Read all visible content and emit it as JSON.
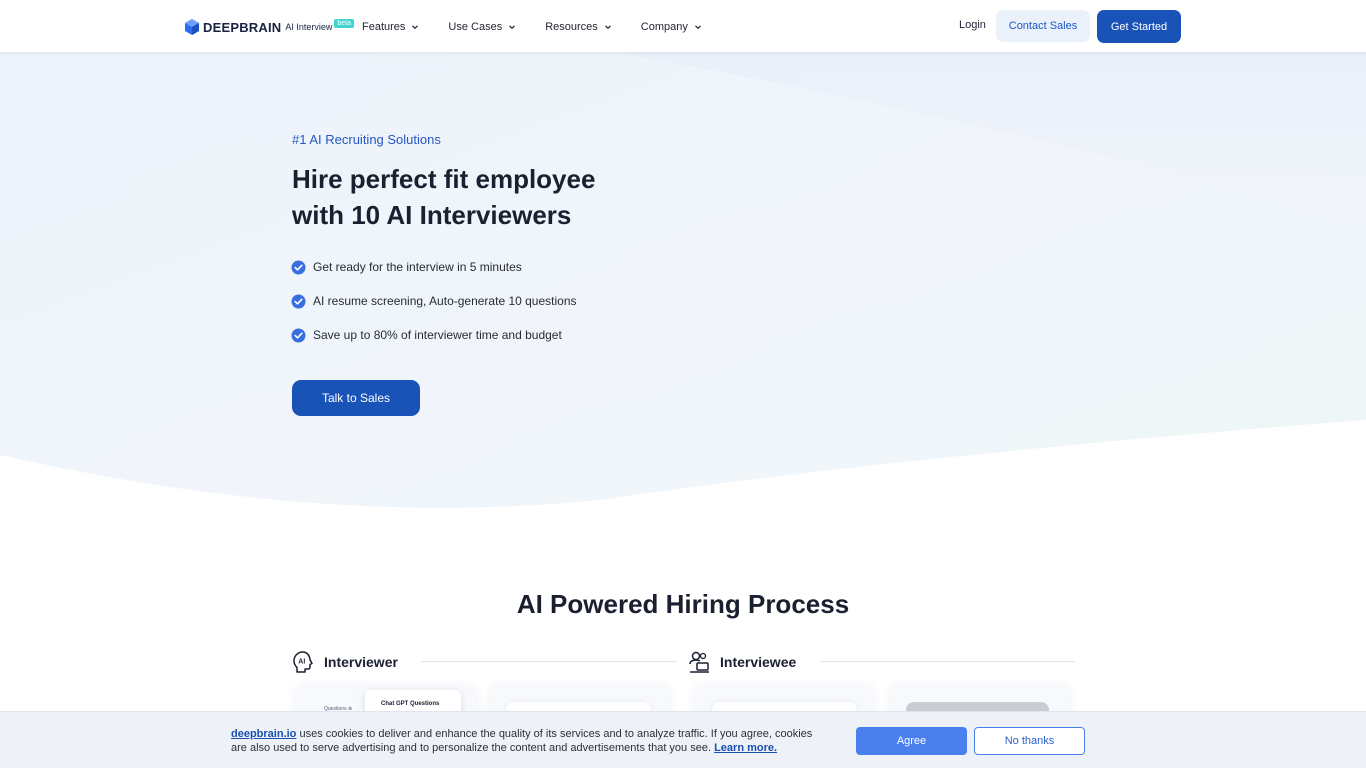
{
  "nav": {
    "brand": "DEEPBRAIN",
    "product": "AI Interview",
    "badge": "beta",
    "menu": [
      {
        "label": "Features"
      },
      {
        "label": "Use Cases"
      },
      {
        "label": "Resources"
      },
      {
        "label": "Company"
      }
    ],
    "login_label": "Login",
    "contact_label": "Contact Sales",
    "start_label": "Get Started"
  },
  "hero": {
    "eyebrow": "#1 AI Recruiting Solutions",
    "title_line1": "Hire perfect fit employee",
    "title_line2": "with 10 AI Interviewers",
    "checks": [
      "Get ready for the interview in 5 minutes",
      "AI resume screening, Auto-generate 10 questions",
      "Save up to 80% of interviewer time and budget"
    ],
    "cta_label": "Talk to Sales"
  },
  "process": {
    "title": "AI Powered Hiring Process",
    "interviewer_label": "Interviewer",
    "interviewee_label": "Interviewee",
    "card_title": "Chat GPT Questions",
    "card_questions": "Questions ⊕"
  },
  "cookie": {
    "site_link": "deepbrain.io",
    "text": " uses cookies to deliver and enhance the quality of its services and to analyze traffic. If you agree, cookies are also used to serve advertising and to personalize the content and advertisements that you see. ",
    "learn_more": "Learn more.",
    "agree_label": "Agree",
    "decline_label": "No thanks"
  },
  "colors": {
    "primary": "#1a53b8",
    "accent_link": "#2458c2",
    "cookie_agree": "#4a80ee",
    "hero_tint": "#eef3fb"
  },
  "icons": [
    "deepbrain-cube-logo",
    "chevron-down-icon",
    "check-circle-icon",
    "ai-head-icon",
    "interviewee-icon"
  ]
}
